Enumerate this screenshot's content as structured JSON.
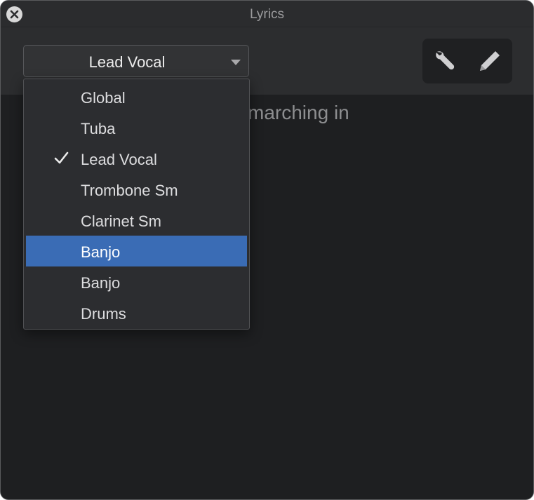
{
  "window": {
    "title": "Lyrics",
    "close_icon": "close-circle-icon"
  },
  "toolbar": {
    "track_select": {
      "value": "Lead Vocal",
      "icon": "chevron-down-icon"
    },
    "tools": [
      {
        "icon": "wrench-icon"
      },
      {
        "icon": "pencil-icon"
      }
    ]
  },
  "content": {
    "lyric_visible_text": "marching in"
  },
  "dropdown": {
    "items": [
      {
        "label": "Global",
        "checked": false,
        "highlighted": false
      },
      {
        "label": "Tuba",
        "checked": false,
        "highlighted": false
      },
      {
        "label": "Lead Vocal",
        "checked": true,
        "highlighted": false
      },
      {
        "label": "Trombone Sm",
        "checked": false,
        "highlighted": false
      },
      {
        "label": "Clarinet Sm",
        "checked": false,
        "highlighted": false
      },
      {
        "label": "Banjo",
        "checked": false,
        "highlighted": true
      },
      {
        "label": "Banjo",
        "checked": false,
        "highlighted": false
      },
      {
        "label": "Drums",
        "checked": false,
        "highlighted": false
      }
    ]
  },
  "colors": {
    "window_bg": "#1e1f21",
    "toolbar_bg": "#2c2d2f",
    "highlight": "#3a6cb5",
    "text": "#dddddf"
  }
}
